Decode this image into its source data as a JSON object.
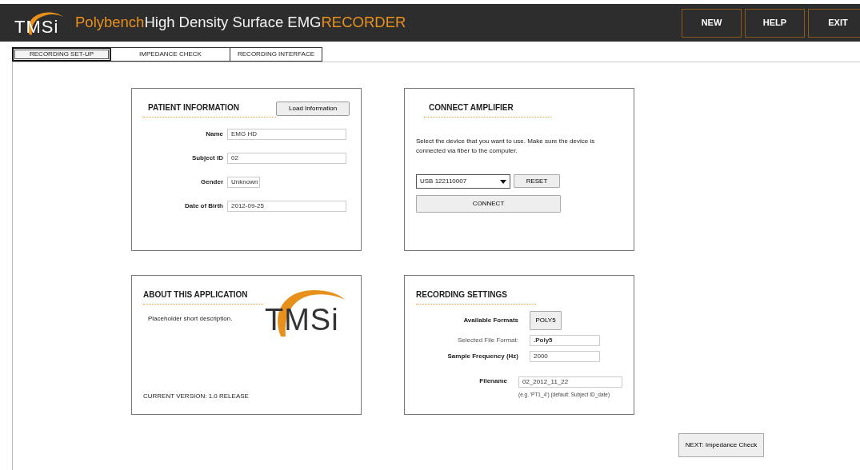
{
  "header": {
    "logo": "TMSi",
    "title_parts": [
      {
        "text": "Polybench",
        "kind": "accent"
      },
      {
        "text": "High Density Surface EMG",
        "kind": "plain"
      },
      {
        "text": "RECORDER",
        "kind": "accent"
      }
    ],
    "buttons": [
      "NEW",
      "HELP",
      "EXIT"
    ]
  },
  "tabs": [
    {
      "label": "RECORDING SET-UP",
      "selected": true
    },
    {
      "label": "IMPEDANCE CHECK",
      "selected": false
    },
    {
      "label": "RECORDING INTERFACE",
      "selected": false
    }
  ],
  "patient": {
    "title": "PATIENT INFORMATION",
    "load_button": "Load Information",
    "fields": [
      {
        "label": "Name",
        "value": "EMG HD",
        "kind": "long"
      },
      {
        "label": "Subject ID",
        "value": "02",
        "kind": "long"
      },
      {
        "label": "Gender",
        "value": "Unknown",
        "kind": "short"
      },
      {
        "label": "Date of Birth",
        "value": "2012-09-25",
        "kind": "long"
      }
    ]
  },
  "amplifier": {
    "title": "CONNECT AMPLIFIER",
    "instructions": "Select the device that you want to use. Make sure the device is connected via fiber to the computer.",
    "device": "USB 122110007",
    "reset_button": "RESET",
    "connect_button": "CONNECT"
  },
  "about": {
    "title": "ABOUT THIS APPLICATION",
    "description": "Placeholder short description.",
    "logo": "TMSi",
    "version": "CURRENT VERSION: 1.0 RELEASE"
  },
  "recording": {
    "title": "RECORDING SETTINGS",
    "rows": [
      {
        "kind": "button",
        "label": "Available Formats",
        "value": "POLY5"
      },
      {
        "kind": "readout",
        "label": "Selected File Format:",
        "value": ".Poly5"
      },
      {
        "kind": "field",
        "label": "Sample Frequency (Hz)",
        "value": "2000"
      },
      {
        "kind": "field",
        "label": "Filename",
        "value": "02_2012_11_22",
        "note": "(e.g. 'PT1_4') (default: Subject ID_date)"
      }
    ]
  },
  "next_button": "NEXT: Impedance Check"
}
